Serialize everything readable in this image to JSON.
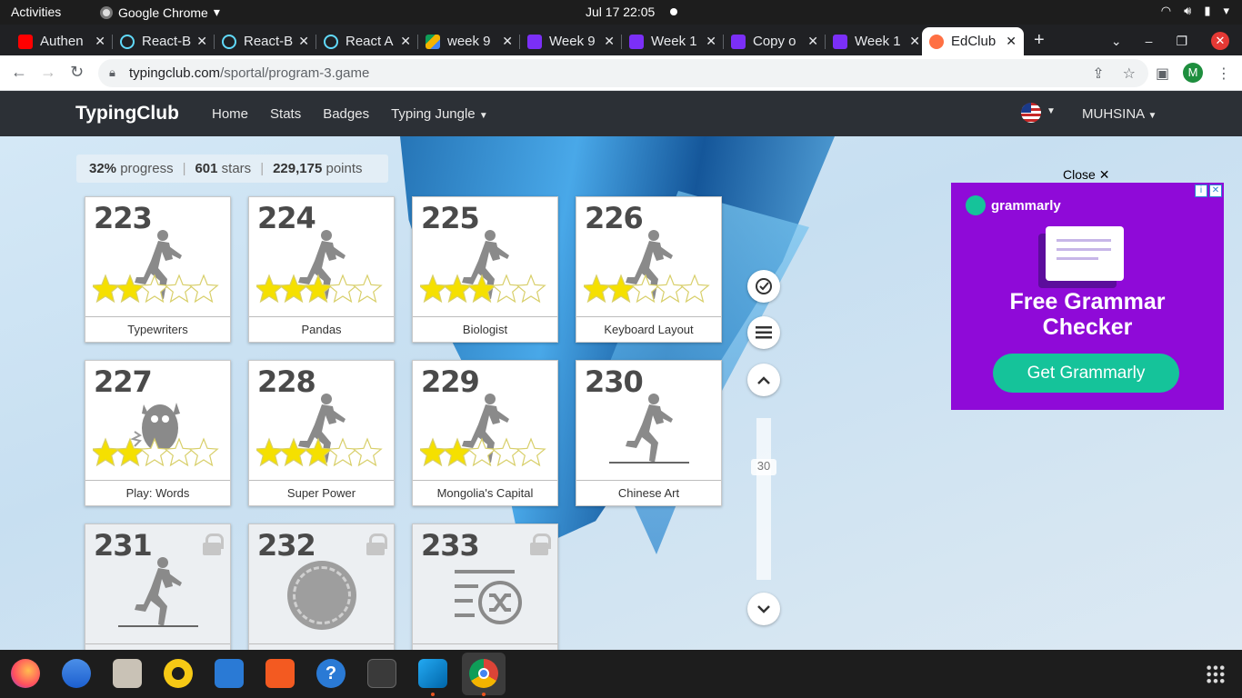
{
  "topbar": {
    "activities": "Activities",
    "app_name": "Google Chrome",
    "clock": "Jul 17  22:05"
  },
  "tabs": [
    {
      "label": "Authen",
      "icon": "youtube-icon"
    },
    {
      "label": "React-B",
      "icon": "react-icon"
    },
    {
      "label": "React-B",
      "icon": "react-icon"
    },
    {
      "label": "React A",
      "icon": "react-icon"
    },
    {
      "label": "week 9",
      "icon": "drive-icon"
    },
    {
      "label": "Week 9",
      "icon": "doc-icon"
    },
    {
      "label": "Week 1",
      "icon": "doc-icon"
    },
    {
      "label": "Copy o",
      "icon": "doc-icon"
    },
    {
      "label": "Week 1",
      "icon": "doc-icon"
    },
    {
      "label": "EdClub",
      "icon": "edclub-icon",
      "active": true
    }
  ],
  "address_bar": {
    "domain": "typingclub.com",
    "path": "/sportal/program-3.game",
    "profile_initial": "M"
  },
  "site_header": {
    "brand": "TypingClub",
    "nav": [
      "Home",
      "Stats",
      "Badges",
      "Typing Jungle"
    ],
    "user": "MUHSINA"
  },
  "stats": {
    "progress_value": "32%",
    "progress_label": "progress",
    "stars_value": "601",
    "stars_label": "stars",
    "points_value": "229,175",
    "points_label": "points"
  },
  "lessons": [
    {
      "number": "223",
      "title": "Typewriters",
      "stars": 2,
      "icon": "runner-icon"
    },
    {
      "number": "224",
      "title": "Pandas",
      "stars": 3,
      "icon": "runner-icon"
    },
    {
      "number": "225",
      "title": "Biologist",
      "stars": 3,
      "icon": "runner-icon"
    },
    {
      "number": "226",
      "title": "Keyboard Layout",
      "stars": 2,
      "icon": "runner-icon"
    },
    {
      "number": "227",
      "title": "Play: Words",
      "stars": 2,
      "icon": "monster-icon"
    },
    {
      "number": "228",
      "title": "Super Power",
      "stars": 3,
      "icon": "runner-icon"
    },
    {
      "number": "229",
      "title": "Mongolia's Capital",
      "stars": 2,
      "icon": "runner-icon"
    },
    {
      "number": "230",
      "title": "Chinese Art",
      "stars": 0,
      "icon": "runner-icon"
    },
    {
      "number": "231",
      "title": "",
      "locked": true,
      "icon": "runner-icon"
    },
    {
      "number": "232",
      "title": "",
      "locked": true,
      "icon": "game-icon"
    },
    {
      "number": "233",
      "title": "",
      "locked": true,
      "icon": "shuffle-icon"
    }
  ],
  "side_controls": {
    "scroll_position": "30"
  },
  "ad": {
    "close_label": "Close",
    "brand": "grammarly",
    "headline_line1": "Free Grammar",
    "headline_line2": "Checker",
    "cta": "Get Grammarly",
    "background": "#8f0ad8",
    "cta_color": "#15c39a"
  },
  "colors": {
    "site_header_bg": "#2c3036",
    "star_fill": "#f5e000"
  }
}
